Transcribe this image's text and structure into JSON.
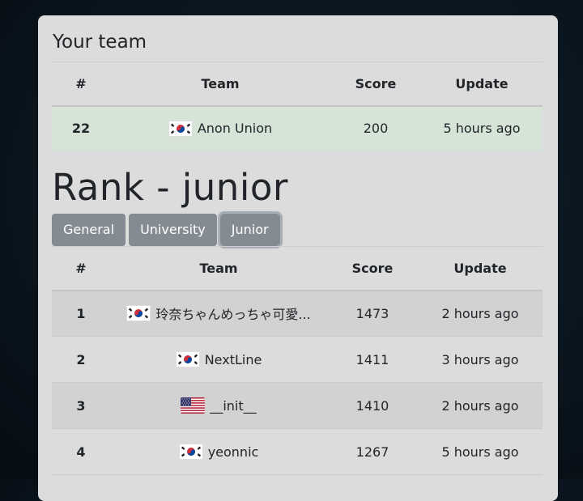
{
  "your_team": {
    "title": "Your team",
    "headers": [
      "#",
      "Team",
      "Score",
      "Update"
    ],
    "row": {
      "rank": "22",
      "flag": "kr",
      "team": "Anon Union",
      "score": "200",
      "update": "5 hours ago"
    }
  },
  "rank": {
    "title": "Rank - junior",
    "tabs": [
      "General",
      "University",
      "Junior"
    ],
    "active_tab": "Junior",
    "headers": [
      "#",
      "Team",
      "Score",
      "Update"
    ],
    "rows": [
      {
        "rank": "1",
        "flag": "kr",
        "team": "玲奈ちゃんめっちゃ可愛...",
        "score": "1473",
        "update": "2 hours ago"
      },
      {
        "rank": "2",
        "flag": "kr",
        "team": "NextLine",
        "score": "1411",
        "update": "3 hours ago"
      },
      {
        "rank": "3",
        "flag": "us",
        "team": "__init__",
        "score": "1410",
        "update": "2 hours ago"
      },
      {
        "rank": "4",
        "flag": "kr",
        "team": "yeonnic",
        "score": "1267",
        "update": "5 hours ago"
      }
    ]
  },
  "colors": {
    "highlight_row": "#d5e4d7",
    "button": "#858b92",
    "card": "#dcdcdc"
  }
}
